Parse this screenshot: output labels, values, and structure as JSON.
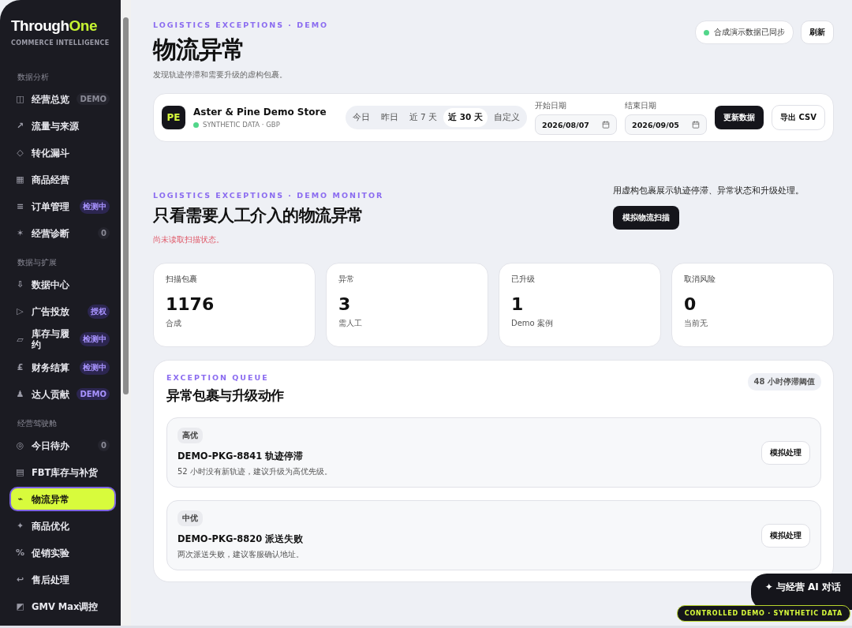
{
  "brand": {
    "name_part1": "Through",
    "name_part2": "One",
    "tagline": "COMMERCE INTELLIGENCE"
  },
  "sidebar": {
    "sections": [
      {
        "title": "数据分析",
        "items": [
          {
            "kind": "muted",
            "icon": "◫",
            "label": "经营总览",
            "badge": "DEMO",
            "selected": false
          },
          {
            "kind": "plain",
            "icon": "↗",
            "label": "流量与来源",
            "selected": false
          },
          {
            "kind": "plain",
            "icon": "◇",
            "label": "转化漏斗",
            "selected": false
          },
          {
            "kind": "plain",
            "icon": "▦",
            "label": "商品经营",
            "selected": false
          },
          {
            "kind": "accent",
            "icon": "≡",
            "label": "订单管理",
            "badge": "检测中",
            "selected": false
          },
          {
            "kind": "muted",
            "icon": "✶",
            "label": "经营诊断",
            "badge": "0",
            "selected": false
          }
        ]
      },
      {
        "title": "数据与扩展",
        "items": [
          {
            "kind": "plain",
            "icon": "⇩",
            "label": "数据中心",
            "selected": false
          },
          {
            "kind": "accent",
            "icon": "▷",
            "label": "广告投放",
            "badge": "授权",
            "selected": false
          },
          {
            "kind": "accent",
            "icon": "▱",
            "label": "库存与履约",
            "badge": "检测中",
            "selected": false
          },
          {
            "kind": "accent",
            "icon": "£",
            "label": "财务结算",
            "badge": "检测中",
            "selected": false
          },
          {
            "kind": "accent",
            "icon": "♟",
            "label": "达人贡献",
            "badge": "DEMO",
            "selected": false
          }
        ]
      },
      {
        "title": "经营驾驶舱",
        "items": [
          {
            "kind": "muted",
            "icon": "◎",
            "label": "今日待办",
            "badge": "0",
            "selected": false
          },
          {
            "kind": "plain",
            "icon": "▤",
            "label": "FBT库存与补货",
            "selected": false
          },
          {
            "kind": "plain",
            "icon": "⌁",
            "label": "物流异常",
            "selected": true
          },
          {
            "kind": "plain",
            "icon": "✦",
            "label": "商品优化",
            "selected": false
          },
          {
            "kind": "plain",
            "icon": "%",
            "label": "促销实验",
            "selected": false
          },
          {
            "kind": "plain",
            "icon": "↩",
            "label": "售后处理",
            "selected": false
          },
          {
            "kind": "plain",
            "icon": "◩",
            "label": "GMV Max调控",
            "selected": false
          }
        ]
      }
    ]
  },
  "header": {
    "eyebrow": "LOGISTICS EXCEPTIONS · DEMO",
    "title": "物流异常",
    "subtitle": "发现轨迹停滞和需要升级的虚构包裹。",
    "sync_status": "合成演示数据已同步",
    "refresh_button": "刷新"
  },
  "store_bar": {
    "avatar": "PE",
    "store_name": "Aster & Pine Demo Store",
    "store_meta": "SYNTHETIC DATA · GBP",
    "ranges": [
      {
        "label": "今日",
        "selected": false
      },
      {
        "label": "昨日",
        "selected": false
      },
      {
        "label": "近 7 天",
        "selected": false
      },
      {
        "label": "近 30 天",
        "selected": true
      },
      {
        "label": "自定义",
        "selected": false
      }
    ],
    "start_label": "开始日期",
    "start_date": "2026/08/07",
    "end_label": "结束日期",
    "end_date": "2026/09/05",
    "update_button": "更新数据",
    "export_button": "导出 CSV"
  },
  "monitor": {
    "eyebrow": "LOGISTICS EXCEPTIONS · DEMO MONITOR",
    "title": "只看需要人工介入的物流异常",
    "status": "尚未读取扫描状态。",
    "description": "用虚构包裹展示轨迹停滞、异常状态和升级处理。",
    "scan_button": "模拟物流扫描"
  },
  "kpis": [
    {
      "label": "扫描包裹",
      "value": "1176",
      "note": "合成"
    },
    {
      "label": "异常",
      "value": "3",
      "note": "需人工"
    },
    {
      "label": "已升级",
      "value": "1",
      "note": "Demo 案例"
    },
    {
      "label": "取消风险",
      "value": "0",
      "note": "当前无"
    }
  ],
  "queue": {
    "eyebrow": "EXCEPTION QUEUE",
    "title": "异常包裹与升级动作",
    "threshold": "48 小时停滞阈值",
    "items": [
      {
        "priority": "高优",
        "title": "DEMO-PKG-8841 轨迹停滞",
        "detail": "52 小时没有新轨迹，建议升级为高优先级。",
        "action": "模拟处理"
      },
      {
        "priority": "中优",
        "title": "DEMO-PKG-8820 派送失败",
        "detail": "两次派送失败，建议客服确认地址。",
        "action": "模拟处理"
      }
    ]
  },
  "ai_button": "✦ 与经营 AI 对话",
  "demo_badge": "CONTROLLED DEMO · SYNTHETIC DATA"
}
